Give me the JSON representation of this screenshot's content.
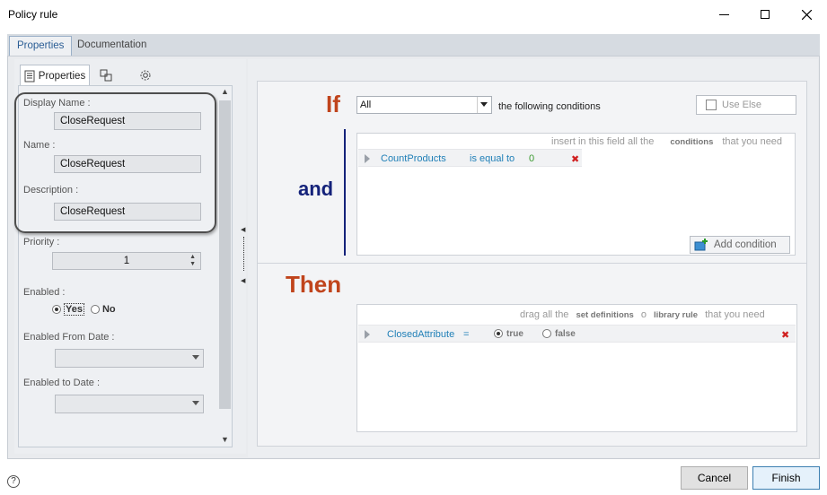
{
  "window": {
    "title": "Policy rule"
  },
  "outer_tabs": {
    "properties": "Properties",
    "documentation": "Documentation"
  },
  "left_panel": {
    "tab_properties": "Properties",
    "display_name": {
      "label": "Display Name :",
      "value": "CloseRequest"
    },
    "name": {
      "label": "Name :",
      "value": "CloseRequest"
    },
    "description": {
      "label": "Description :",
      "value": "CloseRequest"
    },
    "priority": {
      "label": "Priority :",
      "value": "1"
    },
    "enabled": {
      "label": "Enabled :",
      "yes": "Yes",
      "no": "No",
      "selected": "Yes"
    },
    "enabled_from": {
      "label": "Enabled From Date :"
    },
    "enabled_to": {
      "label": "Enabled to Date :"
    }
  },
  "rule": {
    "if_word": "If",
    "match_value": "All",
    "following_text": "the following conditions",
    "use_else_label": "Use Else",
    "and_word": "and",
    "then_word": "Then",
    "conditions_hint": {
      "pre": "insert in this field all the",
      "bold": "conditions",
      "post": "that you need"
    },
    "condition": {
      "field": "CountProducts",
      "operator": "is equal to",
      "value": "0"
    },
    "add_condition_label": "Add condition",
    "actions_hint": {
      "pre": "drag all the",
      "bold1": "set definitions",
      "mid": "o",
      "bold2": "library rule",
      "post": "that you need"
    },
    "action": {
      "field": "ClosedAttribute",
      "operator": "=",
      "true_label": "true",
      "false_label": "false",
      "selected": "true"
    }
  },
  "footer": {
    "help": "?",
    "cancel_label": "Cancel",
    "finish_label": "Finish"
  },
  "colors": {
    "if_then": "#c0441c",
    "and": "#14227a",
    "field_blue": "#1f7fb7",
    "value_green": "#3a9a2e"
  }
}
